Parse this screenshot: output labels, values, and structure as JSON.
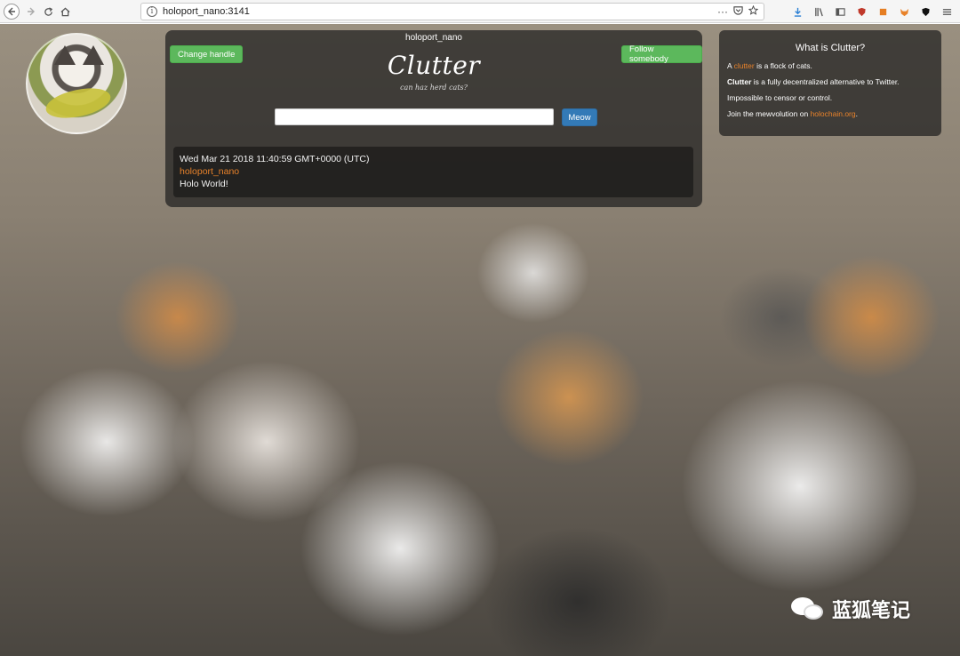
{
  "browser": {
    "url": "holoport_nano:3141",
    "info_icon": "i",
    "back_icon": "back-arrow",
    "forward_icon": "forward-arrow",
    "reload_icon": "reload",
    "home_icon": "home",
    "more_icon": "···",
    "bookmark_icon": "star"
  },
  "header": {
    "handle": "holoport_nano",
    "change_handle_label": "Change handle",
    "follow_label": "Follow somebody",
    "logo": "Clutter",
    "tagline": "can haz herd cats?"
  },
  "composer": {
    "input_value": "",
    "meow_label": "Meow"
  },
  "posts": [
    {
      "timestamp": "Wed Mar 21 2018 11:40:59 GMT+0000 (UTC)",
      "handle": "holoport_nano",
      "message": "Holo World!"
    }
  ],
  "info": {
    "title": "What is Clutter?",
    "line1_prefix": "A ",
    "line1_link": "clutter",
    "line1_suffix": " is a flock of cats.",
    "line2_bold": "Clutter",
    "line2_rest": " is a fully decentralized alternative to Twitter.",
    "line3": "Impossible to censor or control.",
    "line4_prefix": "Join the mewvolution on ",
    "line4_link": "holochain.org",
    "line4_suffix": "."
  },
  "watermark": {
    "text": "蓝狐笔记"
  },
  "colors": {
    "green_button": "#5cb85c",
    "blue_button": "#337ab7",
    "link_orange": "#e8822a",
    "panel_bg": "rgba(30,30,30,0.72)"
  }
}
